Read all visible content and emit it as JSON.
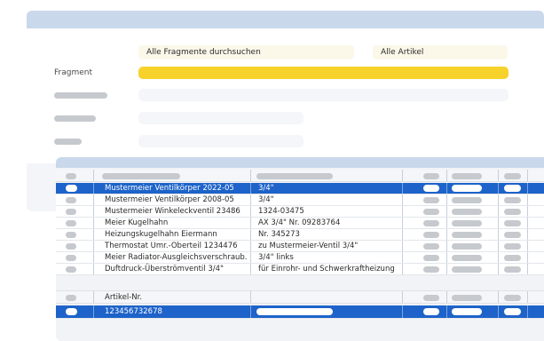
{
  "search": {
    "all_fragments_label": "Alle Fragmente durchsuchen",
    "all_articles_label": "Alle Artikel",
    "fragment_label": "Fragment"
  },
  "results": {
    "rows": [
      {
        "name": "Mustermeier Ventilkörper 2022-05",
        "value": "3/4\"",
        "selected": true
      },
      {
        "name": "Mustermeier Ventilkörper 2008-05",
        "value": "3/4\"",
        "selected": false
      },
      {
        "name": "Mustermeier Winkeleckventil 23486",
        "value": "1324-03475",
        "selected": false
      },
      {
        "name": "Meier Kugelhahn",
        "value": "AX 3/4\" Nr. 09283764",
        "selected": false
      },
      {
        "name": "Heizungskugelhahn Eiermann",
        "value": "Nr. 345273",
        "selected": false
      },
      {
        "name": "Thermostat Umr.-Oberteil 1234476",
        "value": "zu Mustermeier-Ventil 3/4\"",
        "selected": false
      },
      {
        "name": "Meier Radiator-Ausgleichsverschraub.",
        "value": "3/4\" links",
        "selected": false
      },
      {
        "name": "Duftdruck-Überströmventil 3/4\"",
        "value": "für Einrohr- und Schwerkraftheizung",
        "selected": false
      }
    ]
  },
  "articles": {
    "header_label": "Artikel-Nr.",
    "row_value": "123456732678"
  },
  "colors": {
    "accent": "#1d63c9",
    "highlight": "#f6d22b",
    "header": "#c9d8ea"
  }
}
